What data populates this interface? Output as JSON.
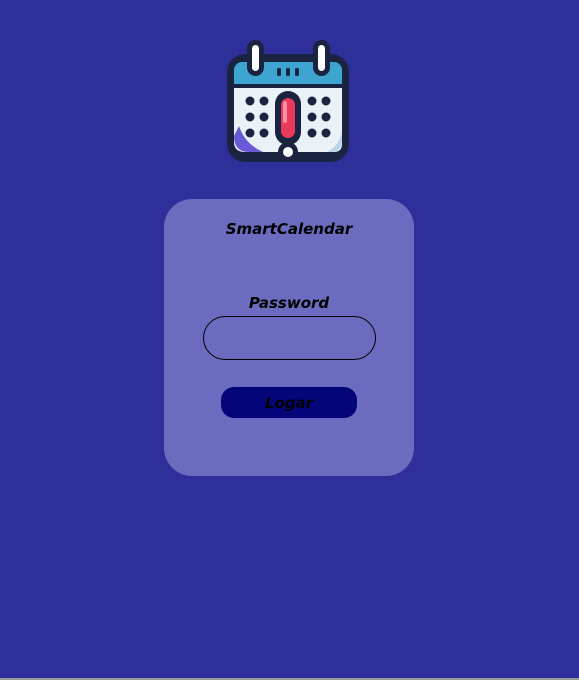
{
  "logo": {
    "icon": "calendar-alert-icon"
  },
  "card": {
    "title": "SmartCalendar",
    "password_label": "Password",
    "password_value": "",
    "login_label": "Logar"
  },
  "colors": {
    "background": "#2f2f9b",
    "card": "#6b6bbf",
    "button": "#05057a"
  }
}
